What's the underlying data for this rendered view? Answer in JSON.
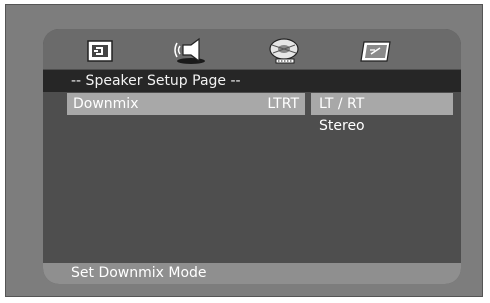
{
  "tabs": [
    {
      "name": "general-setup-icon"
    },
    {
      "name": "speaker-setup-icon"
    },
    {
      "name": "audio-setup-icon"
    },
    {
      "name": "preferences-icon"
    }
  ],
  "page": {
    "title": "-- Speaker Setup Page --"
  },
  "settings": [
    {
      "label": "Downmix",
      "value": "LTRT"
    }
  ],
  "options": [
    {
      "label": "LT / RT",
      "selected": true
    },
    {
      "label": "Stereo",
      "selected": false
    }
  ],
  "status": {
    "hint": "Set Downmix Mode"
  }
}
